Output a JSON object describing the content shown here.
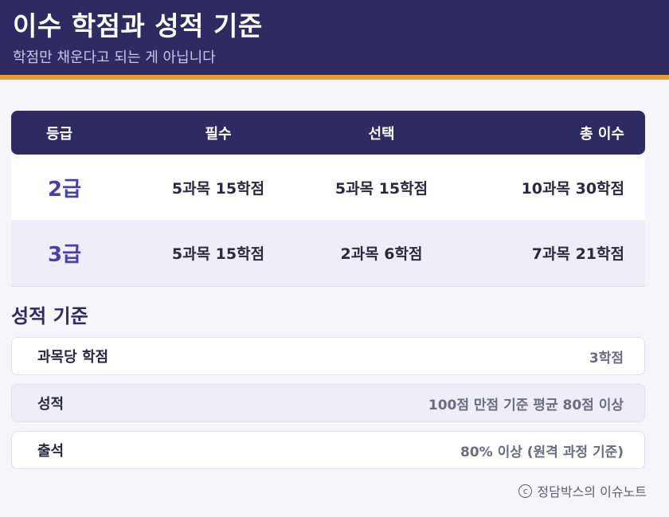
{
  "header": {
    "title": "이수 학점과 성적 기준",
    "subtitle": "학점만 채운다고 되는 게 아닙니다"
  },
  "table": {
    "columns": [
      "등급",
      "필수",
      "선택",
      "총 이수"
    ],
    "rows": [
      {
        "grade": "2급",
        "required": "5과목 15학점",
        "elective": "5과목 15학점",
        "total": "10과목 30학점"
      },
      {
        "grade": "3급",
        "required": "5과목 15학점",
        "elective": "2과목 6학점",
        "total": "7과목 21학점"
      }
    ]
  },
  "criteria": {
    "title": "성적 기준",
    "items": [
      {
        "label": "과목당 학점",
        "value": "3학점"
      },
      {
        "label": "성적",
        "value": "100점 만점 기준 평균 80점 이상"
      },
      {
        "label": "출석",
        "value": "80% 이상 (원격 과정 기준)"
      }
    ]
  },
  "footer": {
    "copyright_symbol": "c",
    "credit": "정담박스의 이슈노트"
  }
}
